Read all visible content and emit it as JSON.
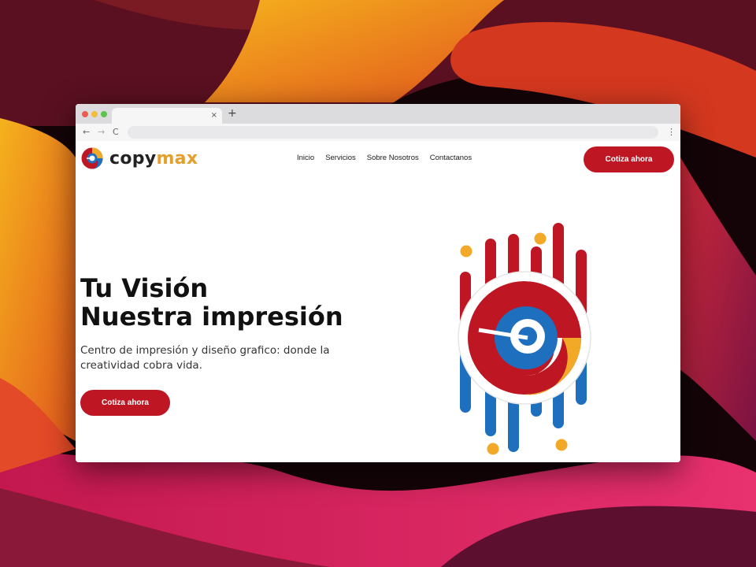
{
  "browser": {
    "tab_close": "×",
    "new_tab": "+",
    "back": "←",
    "forward": "→",
    "reload": "C",
    "menu": "⋮"
  },
  "site": {
    "logo": {
      "part1": "copy",
      "part2": "max"
    },
    "nav": [
      "Inicio",
      "Servicios",
      "Sobre Nosotros",
      "Contactanos"
    ],
    "cta_top": "Cotiza ahora",
    "hero": {
      "title_line1": "Tu Visión",
      "title_line2": "Nuestra impresión",
      "subtitle": "Centro de impresión y diseño grafico: donde la creatividad cobra vida.",
      "cta": "Cotiza ahora"
    }
  },
  "colors": {
    "brand_red": "#be1622",
    "brand_blue": "#1f6fbf",
    "brand_yellow": "#f2a927"
  }
}
